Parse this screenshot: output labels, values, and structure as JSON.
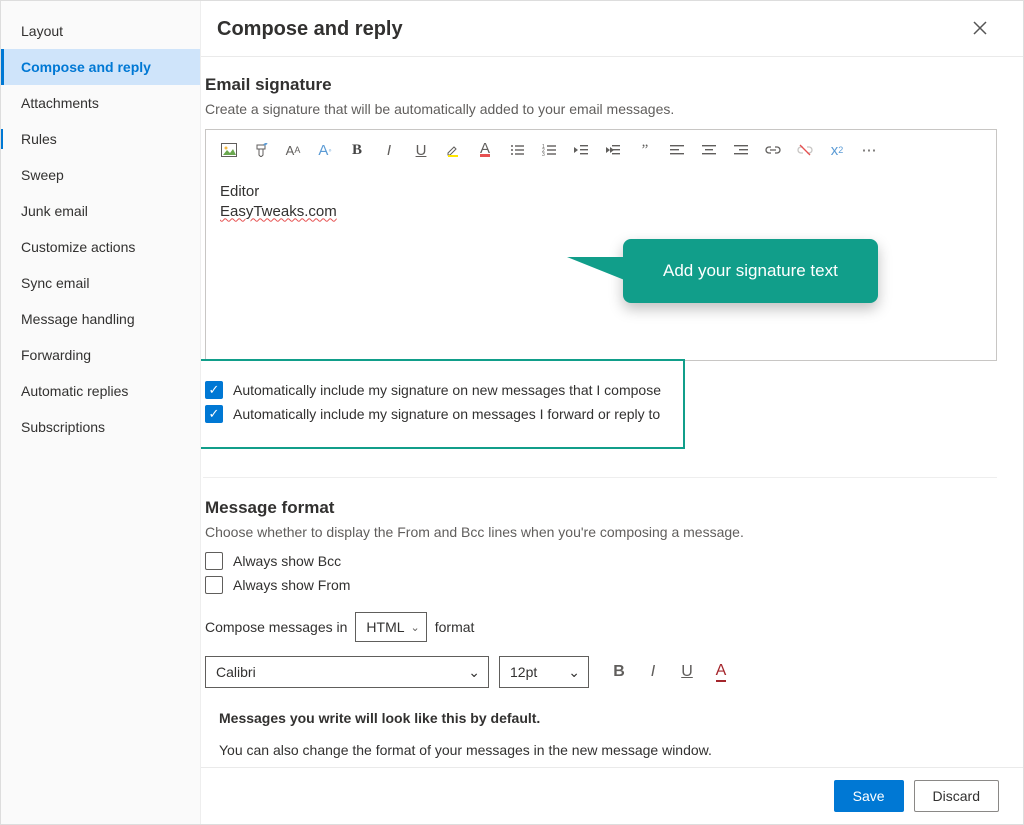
{
  "sidebar": {
    "items": [
      {
        "label": "Layout",
        "active": false
      },
      {
        "label": "Compose and reply",
        "active": true
      },
      {
        "label": "Attachments",
        "active": false
      },
      {
        "label": "Rules",
        "active": false
      },
      {
        "label": "Sweep",
        "active": false
      },
      {
        "label": "Junk email",
        "active": false
      },
      {
        "label": "Customize actions",
        "active": false
      },
      {
        "label": "Sync email",
        "active": false
      },
      {
        "label": "Message handling",
        "active": false
      },
      {
        "label": "Forwarding",
        "active": false
      },
      {
        "label": "Automatic replies",
        "active": false
      },
      {
        "label": "Subscriptions",
        "active": false
      }
    ]
  },
  "header": {
    "title": "Compose and reply"
  },
  "signature": {
    "heading": "Email signature",
    "desc": "Create a signature that will be automatically added to your email messages.",
    "content_line1": "Editor",
    "content_line2": "EasyTweaks.com",
    "callout_text": "Add your signature text",
    "checkbox_new": "Automatically include my signature on new messages that I compose",
    "checkbox_reply": "Automatically include my signature on messages I forward or reply to"
  },
  "format": {
    "heading": "Message format",
    "desc": "Choose whether to display the From and Bcc lines when you're composing a message.",
    "checkbox_bcc": "Always show Bcc",
    "checkbox_from": "Always show From",
    "compose_prefix": "Compose messages in",
    "compose_value": "HTML",
    "compose_suffix": "format",
    "font_value": "Calibri",
    "size_value": "12pt",
    "preview_line1": "Messages you write will look like this by default.",
    "preview_line2": "You can also change the format of your messages in the new message window."
  },
  "footer": {
    "save": "Save",
    "discard": "Discard"
  },
  "icons": {
    "bold": "B",
    "italic": "I",
    "underline": "U",
    "more": "⋯"
  }
}
